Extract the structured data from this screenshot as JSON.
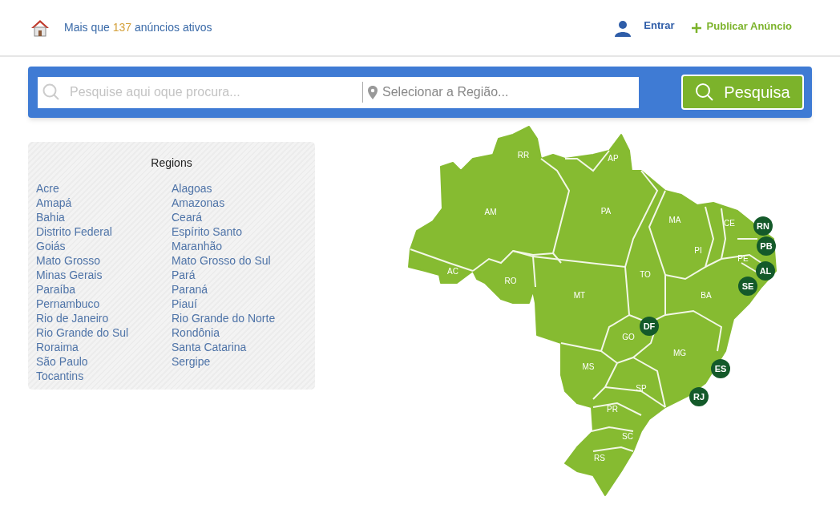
{
  "header": {
    "count_prefix": "Mais que",
    "count": "137",
    "count_suffix": "anúncios ativos",
    "login": "Entrar",
    "publish": "Publicar Anúncio"
  },
  "search": {
    "placeholder": "Pesquise aqui oque procura...",
    "region_placeholder": "Selecionar a Região...",
    "button": "Pesquisa"
  },
  "regions": {
    "title": "Regions",
    "columns": [
      [
        "Acre",
        "Amapá",
        "Bahia",
        "Distrito Federal",
        "Goiás",
        "Mato Grosso",
        "Minas Gerais",
        "Paraíba",
        "Pernambuco",
        "Rio de Janeiro",
        "Rio Grande do Sul",
        "Roraima",
        "São Paulo",
        "Tocantins"
      ],
      [
        "Alagoas",
        "Amazonas",
        "Ceará",
        "Espírito Santo",
        "Maranhão",
        "Mato Grosso do Sul",
        "Pará",
        "Paraná",
        "Piauí",
        "Rio Grande do Norte",
        "Rondônia",
        "Santa Catarina",
        "Sergipe"
      ]
    ]
  },
  "map": {
    "states": [
      {
        "label": "RR",
        "kind": "plain"
      },
      {
        "label": "AP",
        "kind": "plain"
      },
      {
        "label": "AM",
        "kind": "plain"
      },
      {
        "label": "PA",
        "kind": "plain"
      },
      {
        "label": "MA",
        "kind": "plain"
      },
      {
        "label": "CE",
        "kind": "plain"
      },
      {
        "label": "RN",
        "kind": "badge"
      },
      {
        "label": "PB",
        "kind": "badge"
      },
      {
        "label": "PI",
        "kind": "plain"
      },
      {
        "label": "PE",
        "kind": "plain"
      },
      {
        "label": "AC",
        "kind": "plain"
      },
      {
        "label": "RO",
        "kind": "plain"
      },
      {
        "label": "TO",
        "kind": "plain"
      },
      {
        "label": "AL",
        "kind": "badge"
      },
      {
        "label": "MT",
        "kind": "plain"
      },
      {
        "label": "BA",
        "kind": "plain"
      },
      {
        "label": "SE",
        "kind": "badge"
      },
      {
        "label": "GO",
        "kind": "plain"
      },
      {
        "label": "DF",
        "kind": "badge"
      },
      {
        "label": "MG",
        "kind": "plain"
      },
      {
        "label": "MS",
        "kind": "plain"
      },
      {
        "label": "ES",
        "kind": "badge"
      },
      {
        "label": "SP",
        "kind": "plain"
      },
      {
        "label": "RJ",
        "kind": "badge"
      },
      {
        "label": "PR",
        "kind": "plain"
      },
      {
        "label": "SC",
        "kind": "plain"
      },
      {
        "label": "RS",
        "kind": "plain"
      }
    ]
  }
}
